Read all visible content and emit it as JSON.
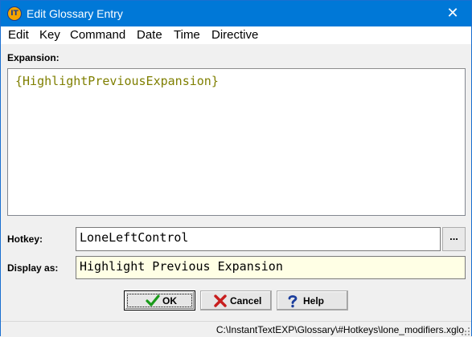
{
  "window": {
    "title": "Edit Glossary Entry",
    "app_icon_text": "IT",
    "close_glyph": "✕"
  },
  "menu": [
    "Edit",
    "Key",
    "Command",
    "Date",
    "Time",
    "Directive"
  ],
  "expansion": {
    "label": "Expansion:",
    "text": "{HighlightPreviousExpansion}"
  },
  "hotkey": {
    "label": "Hotkey:",
    "value": "LoneLeftControl",
    "browse_label": "..."
  },
  "display_as": {
    "label": "Display as:",
    "value": "Highlight Previous Expansion"
  },
  "buttons": {
    "ok": "OK",
    "cancel": "Cancel",
    "help": "Help"
  },
  "status": {
    "path": "C:\\InstantTextEXP\\Glossary\\#Hotkeys\\lone_modifiers.xglo"
  },
  "colors": {
    "titlebar": "#0078d7",
    "expansion_text": "#7f7f00",
    "display_bg": "#ffffe5",
    "ok_check": "#1a9a1a",
    "cancel_x": "#c81e1e",
    "help_icon": "#1b3d9c"
  }
}
